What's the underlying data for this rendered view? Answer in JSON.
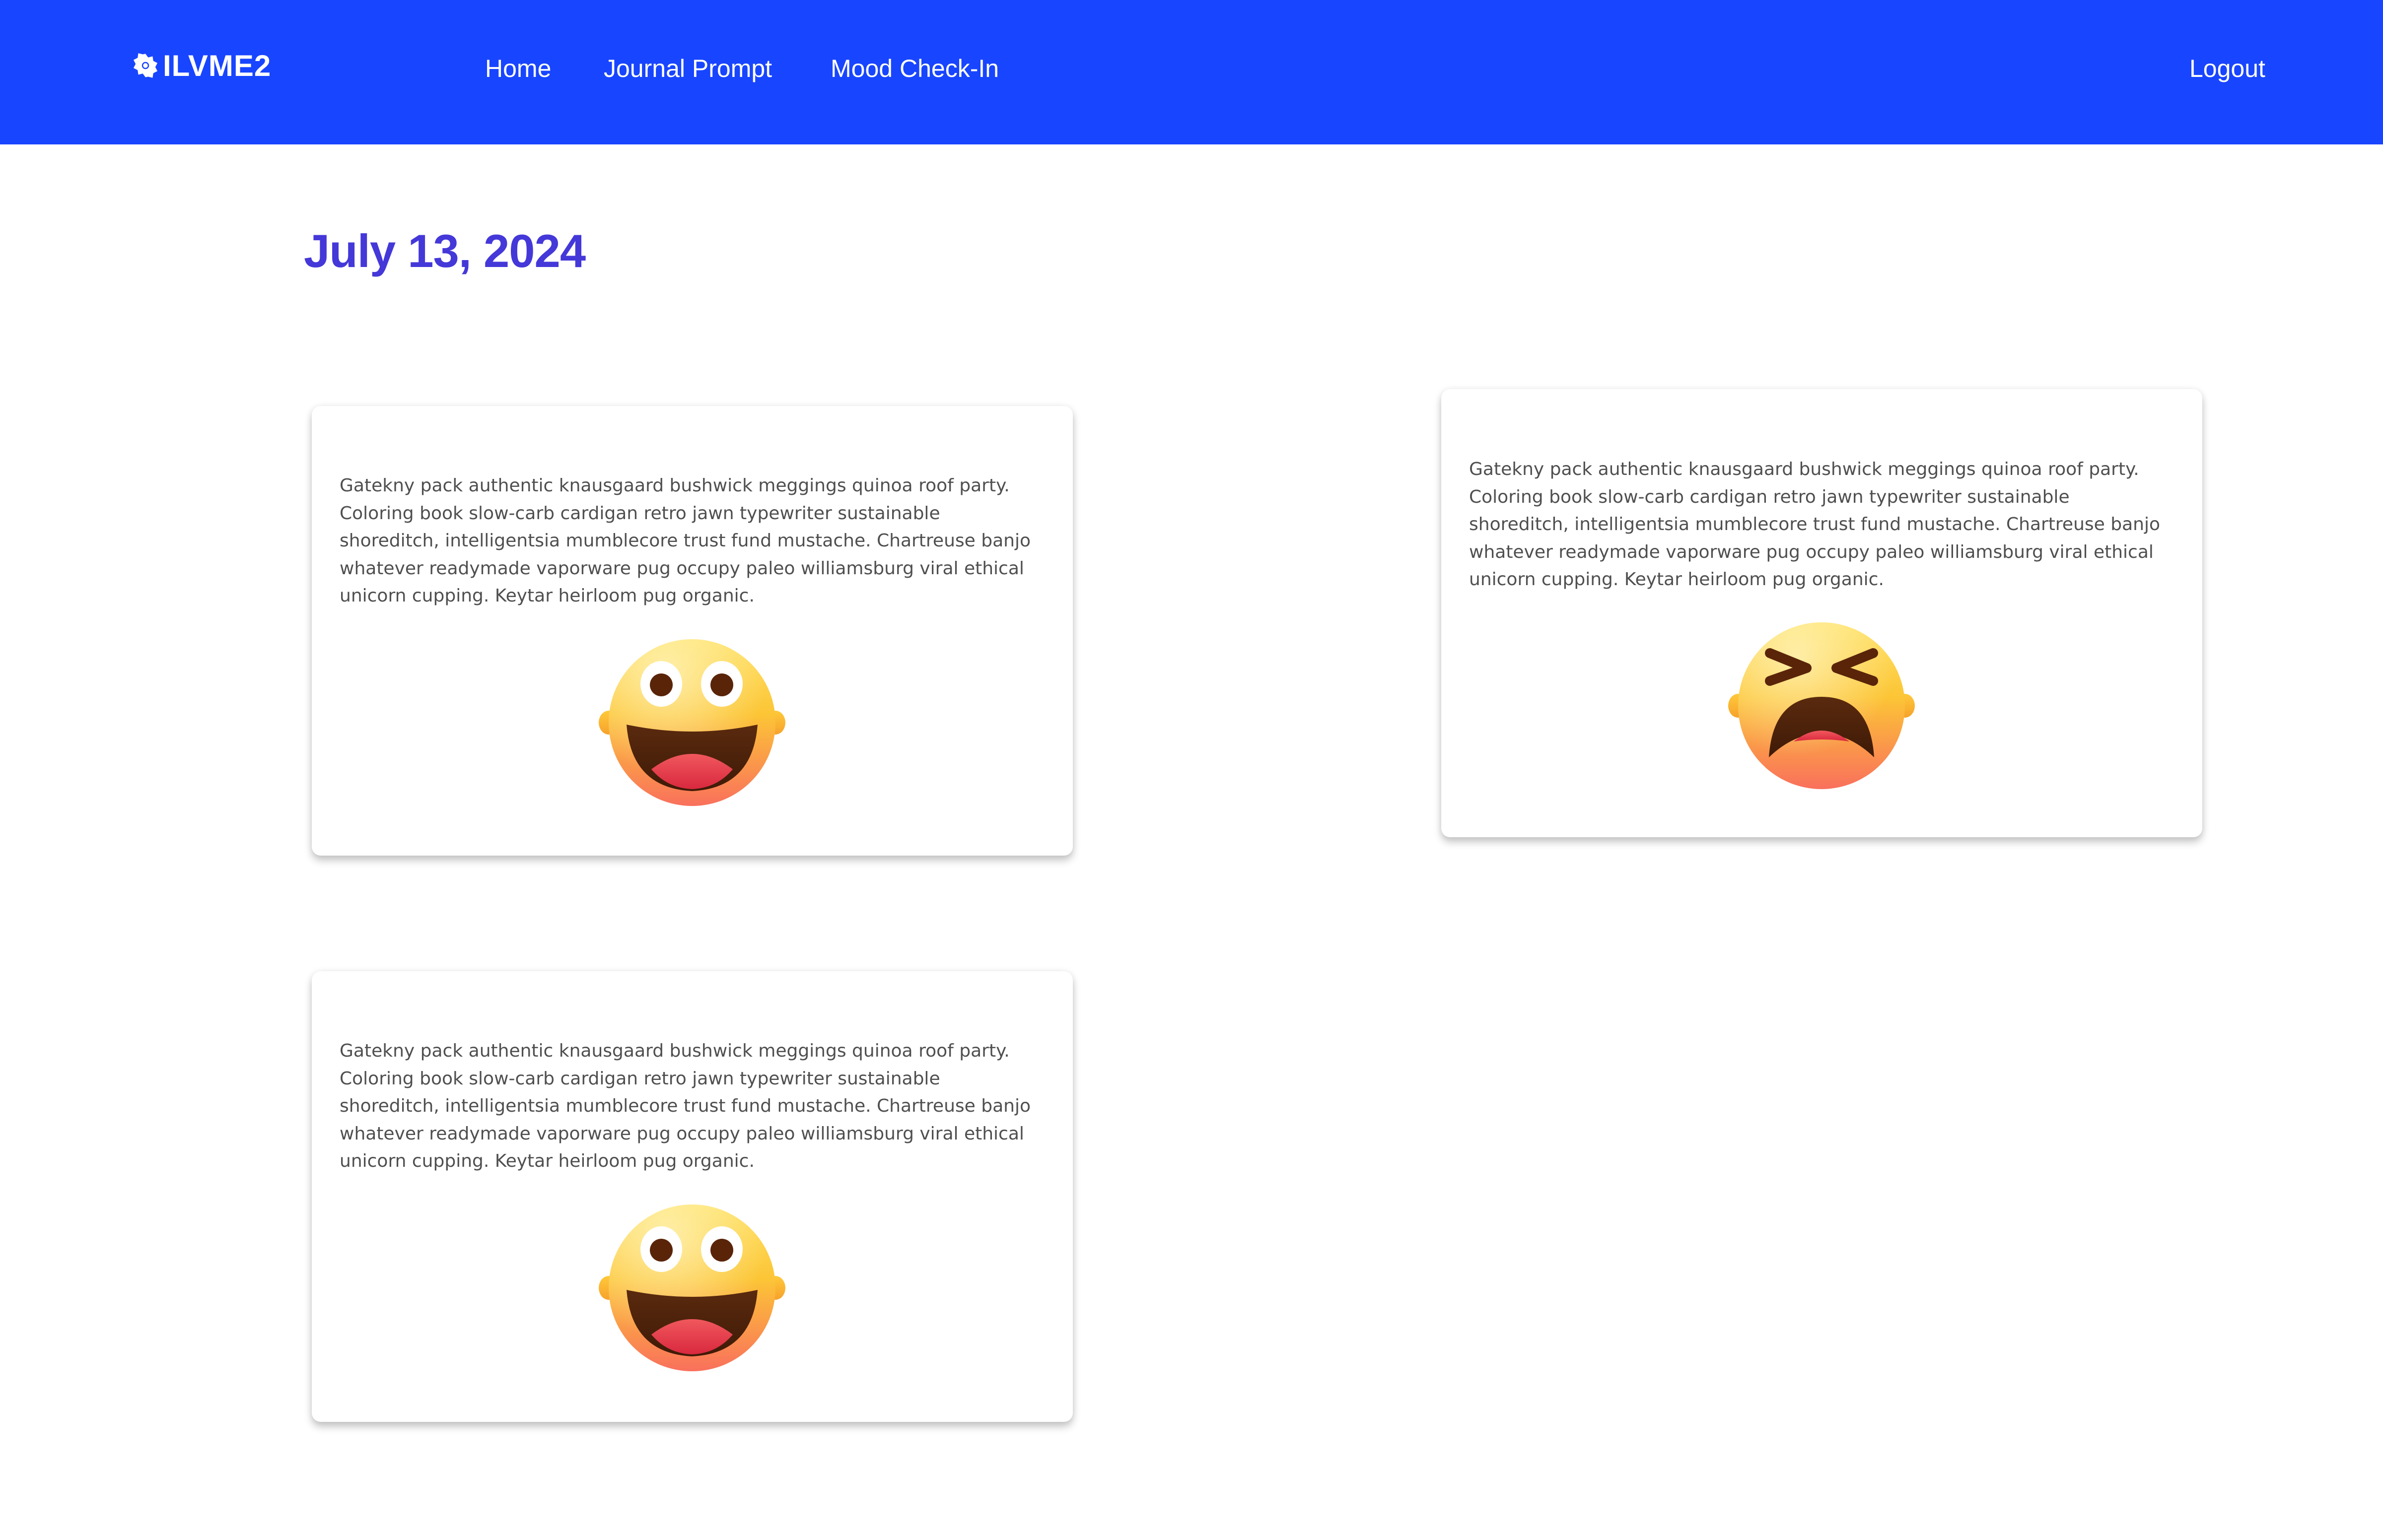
{
  "navbar": {
    "brand": "ILVME2",
    "brand_icon": "asterisk-badge-icon",
    "links": {
      "home": "Home",
      "journal_prompt": "Journal Prompt",
      "mood_checkin": "Mood Check-In"
    },
    "logout": "Logout",
    "background_color": "#1845ff"
  },
  "page": {
    "date": "July 13, 2024",
    "date_color": "#4438d9"
  },
  "entries": [
    {
      "text": "Gatekny pack authentic knausgaard bushwick meggings quinoa roof party. Coloring book slow-carb cardigan retro jawn typewriter sustainable shoreditch, intelligentsia mumblecore trust fund mustache. Chartreuse banjo whatever readymade vaporware pug occupy paleo williamsburg viral ethical unicorn cupping. Keytar heirloom pug organic.",
      "mood_icon": "grinning-face-icon"
    },
    {
      "text": "Gatekny pack authentic knausgaard bushwick meggings quinoa roof party. Coloring book slow-carb cardigan retro jawn typewriter sustainable shoreditch, intelligentsia mumblecore trust fund mustache. Chartreuse banjo whatever readymade vaporware pug occupy paleo williamsburg viral ethical unicorn cupping. Keytar heirloom pug organic.",
      "mood_icon": "tired-face-icon"
    },
    {
      "text": "Gatekny pack authentic knausgaard bushwick meggings quinoa roof party. Coloring book slow-carb cardigan retro jawn typewriter sustainable shoreditch, intelligentsia mumblecore trust fund mustache. Chartreuse banjo whatever readymade vaporware pug occupy paleo williamsburg viral ethical unicorn cupping. Keytar heirloom pug organic.",
      "mood_icon": "grinning-face-icon"
    }
  ]
}
